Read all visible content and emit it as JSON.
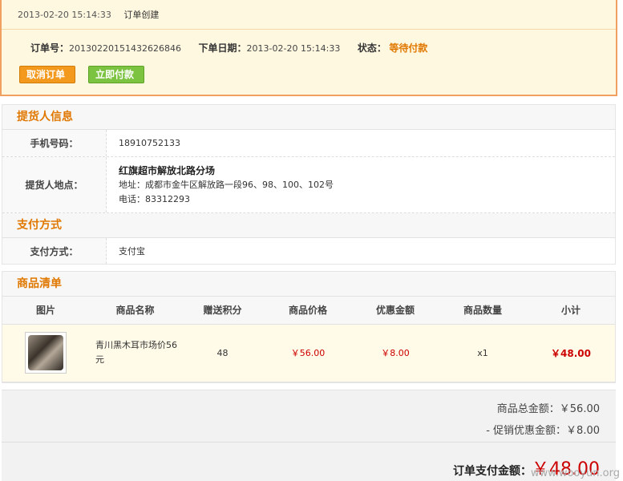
{
  "order_log": {
    "time": "2013-02-20 15:14:33",
    "event": "订单创建"
  },
  "order_info": {
    "order_no_label": "订单号：",
    "order_no": "20130220151432626846",
    "date_label": "下单日期：",
    "date": "2013-02-20 15:14:33",
    "status_label": "状态：",
    "status": "等待付款"
  },
  "buttons": {
    "cancel": "取消订单",
    "pay": "立即付款"
  },
  "pickup": {
    "title": "提货人信息",
    "phone_label": "手机号码：",
    "phone": "18910752133",
    "address_label": "提货人地点：",
    "store_name": "红旗超市解放北路分场",
    "address": "地址：成都市金牛区解放路一段96、98、100、102号",
    "tel": "电话：83312293"
  },
  "payment": {
    "title": "支付方式",
    "label": "支付方式：",
    "value": "支付宝"
  },
  "goods": {
    "title": "商品清单",
    "headers": [
      "图片",
      "商品名称",
      "赠送积分",
      "商品价格",
      "优惠金额",
      "商品数量",
      "小计"
    ],
    "items": [
      {
        "name": "青川黑木耳市场价56元",
        "points": "48",
        "price": "￥56.00",
        "discount": "￥8.00",
        "qty": "x1",
        "subtotal": "￥48.00"
      }
    ]
  },
  "summary": {
    "goods_total": "商品总金额：￥56.00",
    "promo_discount": "- 促销优惠金额：￥8.00",
    "pay_label": "订单支付金额：",
    "pay_amount": "￥48.00"
  },
  "watermark": "www.wooyun.org"
}
